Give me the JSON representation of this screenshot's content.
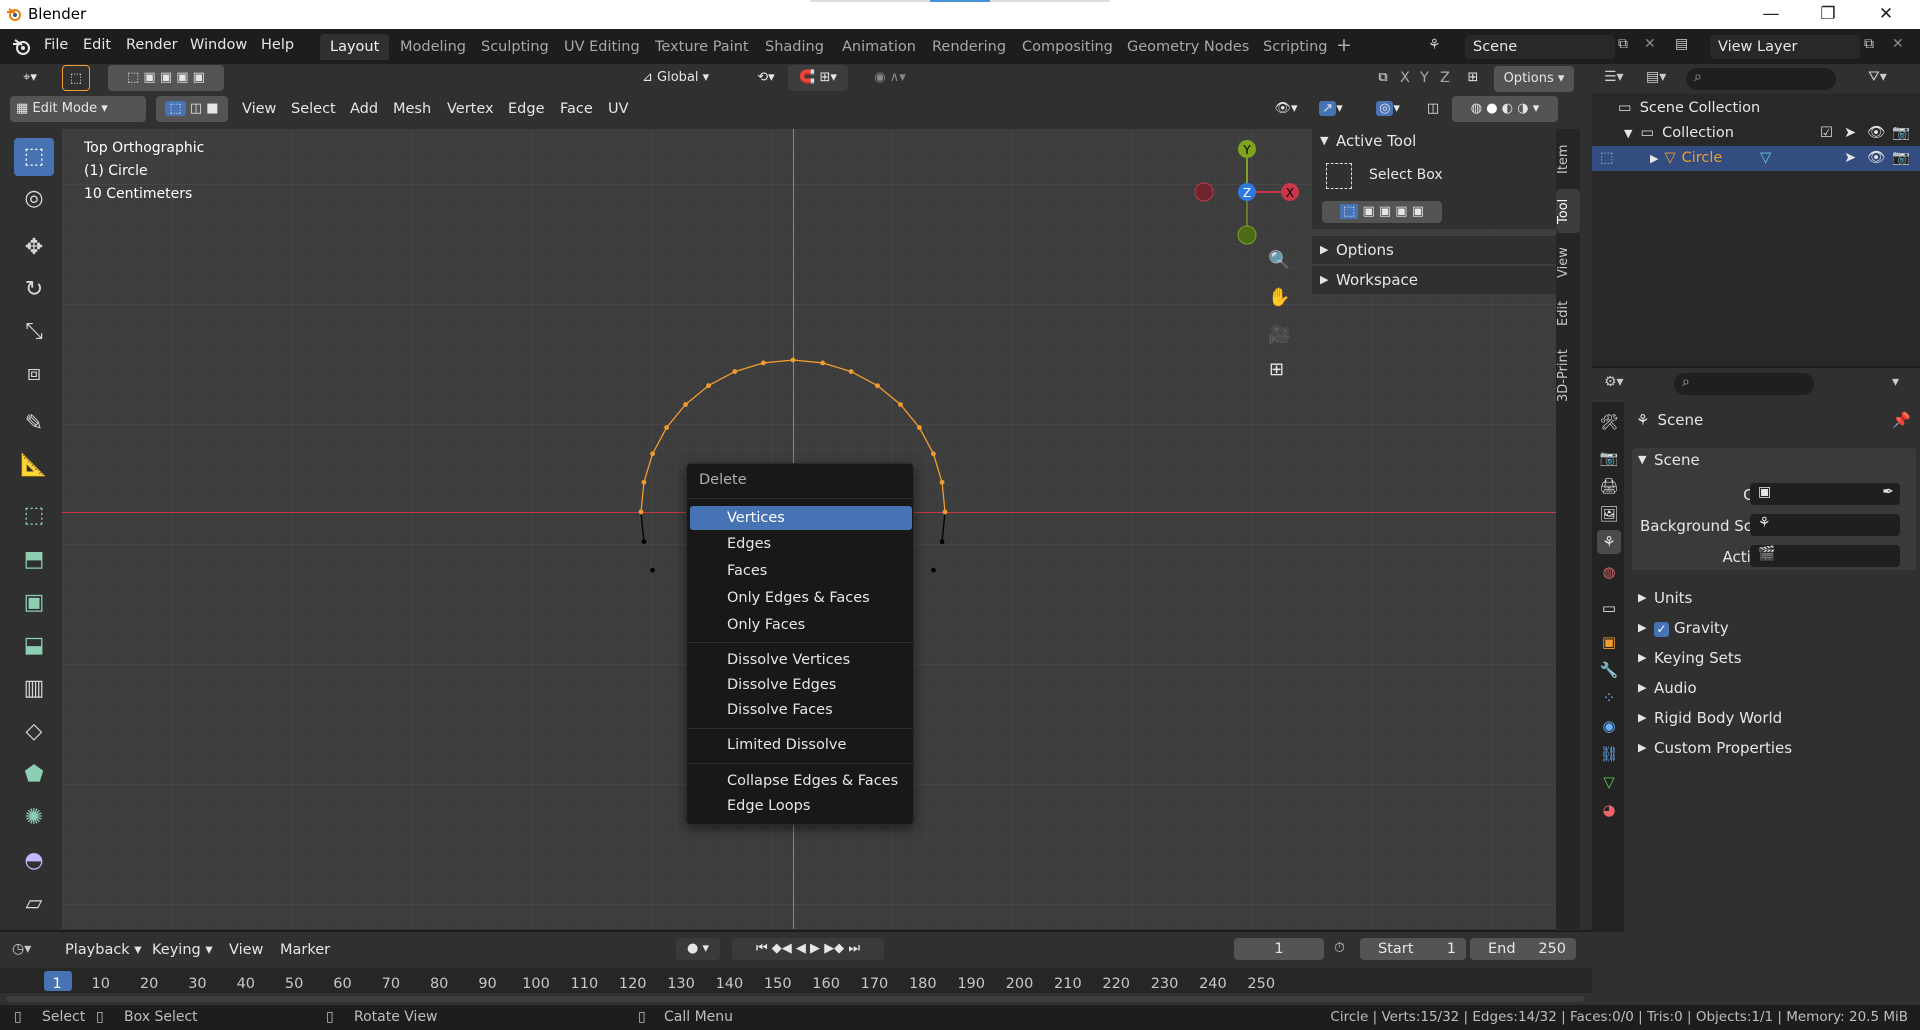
{
  "window": {
    "title": "Blender",
    "minimize": "—",
    "restore": "❐",
    "close": "✕"
  },
  "menu": [
    "File",
    "Edit",
    "Render",
    "Window",
    "Help"
  ],
  "workspaces": [
    {
      "label": "Layout",
      "active": true
    },
    {
      "label": "Modeling"
    },
    {
      "label": "Sculpting"
    },
    {
      "label": "UV Editing"
    },
    {
      "label": "Texture Paint"
    },
    {
      "label": "Shading"
    },
    {
      "label": "Animation"
    },
    {
      "label": "Rendering"
    },
    {
      "label": "Compositing"
    },
    {
      "label": "Geometry Nodes"
    },
    {
      "label": "Scripting"
    }
  ],
  "add_workspace": "+",
  "scene": {
    "name": "Scene",
    "view_layer": "View Layer"
  },
  "header": {
    "orientation": "Global",
    "options": "Options",
    "x": "X",
    "y": "Y",
    "z": "Z"
  },
  "mode": {
    "label": "Edit Mode"
  },
  "viewport_menu": [
    "View",
    "Select",
    "Add",
    "Mesh",
    "Vertex",
    "Edge",
    "Face",
    "UV"
  ],
  "viewport_info": {
    "line1": "Top Orthographic",
    "line2": "(1) Circle",
    "line3": "10 Centimeters"
  },
  "gizmo": {
    "x": "X",
    "y": "Y",
    "z": "Z"
  },
  "delete_menu": {
    "title": "Delete",
    "groups": [
      [
        "Vertices",
        "Edges",
        "Faces",
        "Only Edges & Faces",
        "Only Faces"
      ],
      [
        "Dissolve Vertices",
        "Dissolve Edges",
        "Dissolve Faces"
      ],
      [
        "Limited Dissolve"
      ],
      [
        "Collapse Edges & Faces",
        "Edge Loops"
      ]
    ],
    "selected": "Vertices"
  },
  "npanel": {
    "active_tool": "Active Tool",
    "tool_name": "Select Box",
    "options": "Options",
    "workspace": "Workspace",
    "tabs": [
      "Item",
      "Tool",
      "View",
      "Edit",
      "3D-Print"
    ],
    "active_tab": "Tool"
  },
  "outliner": {
    "scene_collection": "Scene Collection",
    "collection": "Collection",
    "object": "Circle"
  },
  "properties": {
    "breadcrumb": "Scene",
    "section": "Scene",
    "camera": "Camera",
    "background": "Background Sc...",
    "active_clip": "Active Clip",
    "panels": [
      "Units",
      "Gravity",
      "Keying Sets",
      "Audio",
      "Rigid Body World",
      "Custom Properties"
    ]
  },
  "timeline": {
    "menu": [
      "Playback",
      "Keying",
      "View",
      "Marker"
    ],
    "current_frame": "1",
    "start_label": "Start",
    "start": "1",
    "end_label": "End",
    "end": "250",
    "ticks": [
      "1",
      "10",
      "20",
      "30",
      "40",
      "50",
      "60",
      "70",
      "80",
      "90",
      "100",
      "110",
      "120",
      "130",
      "140",
      "150",
      "160",
      "170",
      "180",
      "190",
      "200",
      "210",
      "220",
      "230",
      "240",
      "250"
    ]
  },
  "status": {
    "select": "Select",
    "box_select": "Box Select",
    "rotate": "Rotate View",
    "call_menu": "Call Menu",
    "stats": "Circle | Verts:15/32 | Edges:14/32 | Faces:0/0 | Tris:0 | Objects:1/1 | Memory: 20.5 MiB"
  },
  "colors": {
    "accent": "#4772b3",
    "x_axis": "#c8374a",
    "y_axis": "#7fa31c",
    "selected_vertex": "#f29c2f",
    "unselected_vertex": "#000000"
  }
}
